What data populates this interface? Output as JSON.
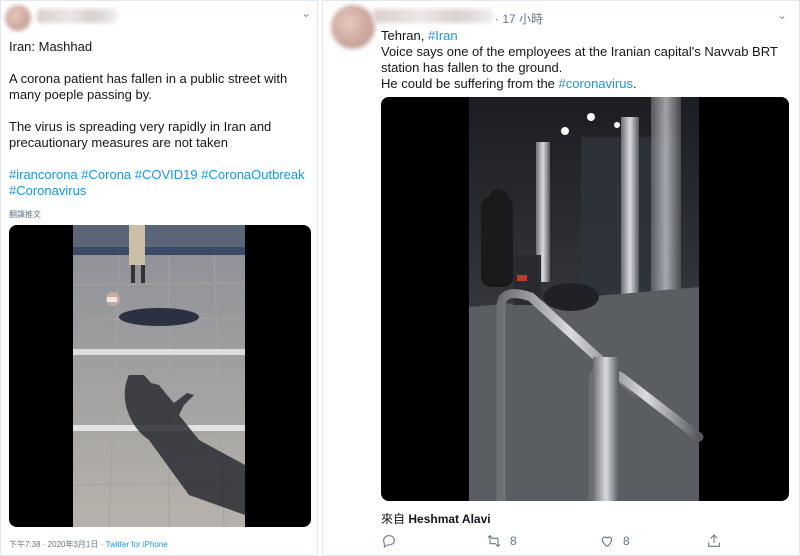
{
  "left_tweet": {
    "lines": [
      "Iran: Mashhad",
      "A corona patient has fallen in a public street with",
      "many poeple passing by.",
      "The virus is spreading very rapidly in Iran and",
      "precautionary measures are not taken"
    ],
    "hashtags_line1": [
      "#irancorona",
      "#Corona",
      "#COVID19",
      "#CoronaOutbreak"
    ],
    "hashtags_line2": [
      "#Coronavirus"
    ],
    "translate": "翻譯推文",
    "timestamp": "下午7:38 · 2020年3月1日 ·",
    "source": "Twitter for iPhone"
  },
  "right_tweet": {
    "time_ago": "· 17 小時",
    "line1_prefix": "Tehran,",
    "line1_tag": "#Iran",
    "line2": "Voice says one of the employees at the Iranian capital's Navvab BRT",
    "line3": "station has fallen to the ground.",
    "line4_prefix": "He could be suffering from the",
    "line4_tag": "#coronavirus",
    "line4_suffix": ".",
    "from_label": "來自",
    "from_name": "Heshmat Alavi",
    "retweets": "8",
    "likes": "8"
  },
  "colors": {
    "link": "#1b95e0",
    "border": "#e1e8ed",
    "muted": "#657786"
  }
}
